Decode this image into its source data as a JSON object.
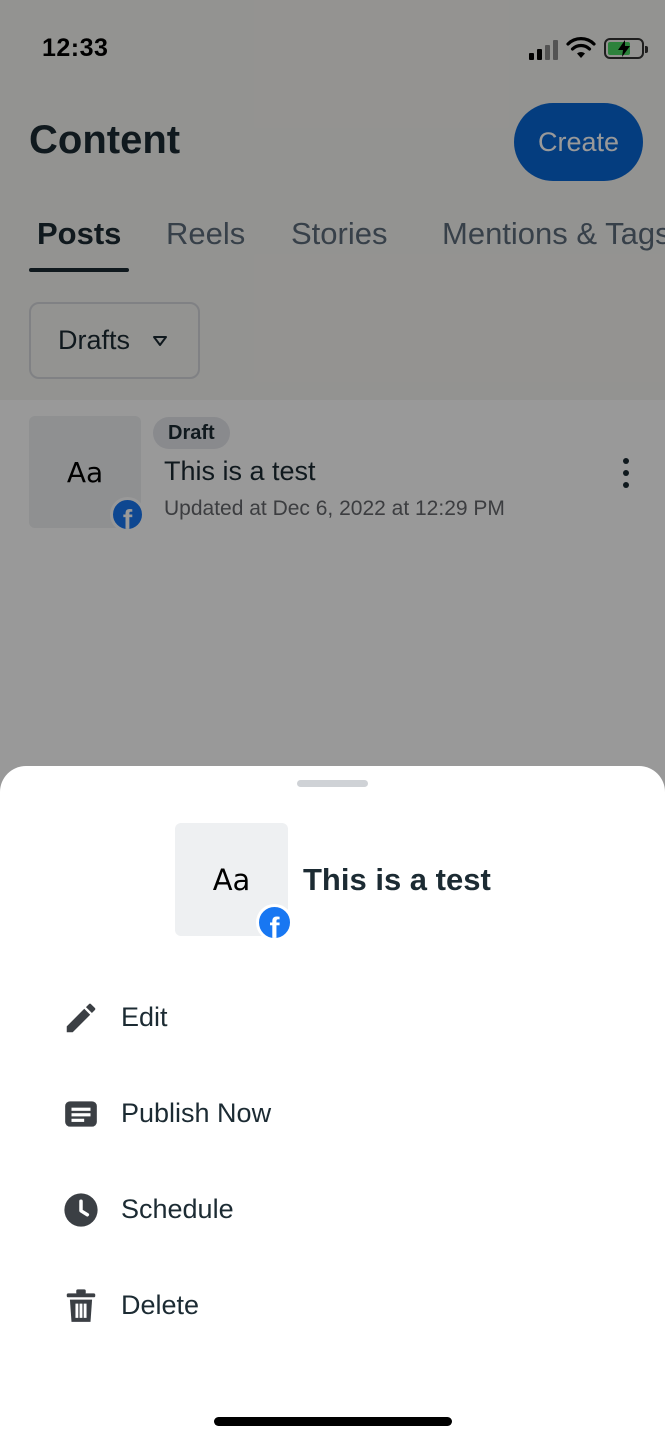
{
  "status_bar": {
    "time": "12:33"
  },
  "header": {
    "title": "Content",
    "create_label": "Create"
  },
  "tabs": [
    {
      "label": "Posts",
      "active": true
    },
    {
      "label": "Reels",
      "active": false
    },
    {
      "label": "Stories",
      "active": false
    },
    {
      "label": "Mentions & Tags",
      "active": false
    }
  ],
  "filter": {
    "selected": "Drafts"
  },
  "post": {
    "thumb_text": "Aa",
    "badge": "Draft",
    "title": "This is a test",
    "updated": "Updated at Dec 6, 2022 at 12:29 PM",
    "platform_icon": "facebook-icon"
  },
  "sheet": {
    "thumb_text": "Aa",
    "title": "This is a test",
    "items": [
      {
        "label": "Edit",
        "icon": "pencil-icon"
      },
      {
        "label": "Publish Now",
        "icon": "publish-icon"
      },
      {
        "label": "Schedule",
        "icon": "clock-icon"
      },
      {
        "label": "Delete",
        "icon": "trash-icon"
      }
    ]
  },
  "colors": {
    "accent": "#0866d4",
    "facebook": "#1877f2",
    "text_primary": "#1c2b33",
    "text_secondary": "#65676b",
    "overlay": "rgba(0,0,0,0.40)"
  }
}
